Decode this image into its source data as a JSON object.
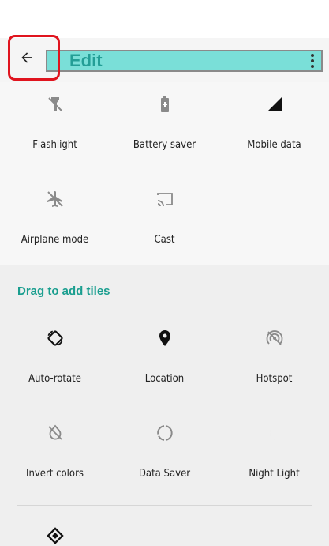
{
  "header": {
    "title": "Edit",
    "back_icon": "arrow-back-icon",
    "overflow_icon": "more-vert-icon"
  },
  "active_tiles": [
    {
      "label": "Flashlight",
      "icon": "flashlight-off-icon"
    },
    {
      "label": "Battery saver",
      "icon": "battery-saver-icon"
    },
    {
      "label": "Mobile data",
      "icon": "mobile-signal-icon"
    },
    {
      "label": "Airplane mode",
      "icon": "airplane-off-icon"
    },
    {
      "label": "Cast",
      "icon": "cast-icon"
    }
  ],
  "available": {
    "section_title": "Drag to add tiles",
    "tiles": [
      {
        "label": "Auto-rotate",
        "icon": "auto-rotate-icon"
      },
      {
        "label": "Location",
        "icon": "location-pin-icon"
      },
      {
        "label": "Hotspot",
        "icon": "hotspot-icon"
      },
      {
        "label": "Invert colors",
        "icon": "invert-colors-icon"
      },
      {
        "label": "Data Saver",
        "icon": "data-saver-icon"
      },
      {
        "label": "Night Light",
        "icon": "night-light-icon"
      }
    ],
    "partial_tile_icon": "diamond-icon"
  },
  "colors": {
    "accent": "#1a9e8f",
    "title_highlight": "#7adfd8",
    "annotation_box": "#e0141e"
  }
}
